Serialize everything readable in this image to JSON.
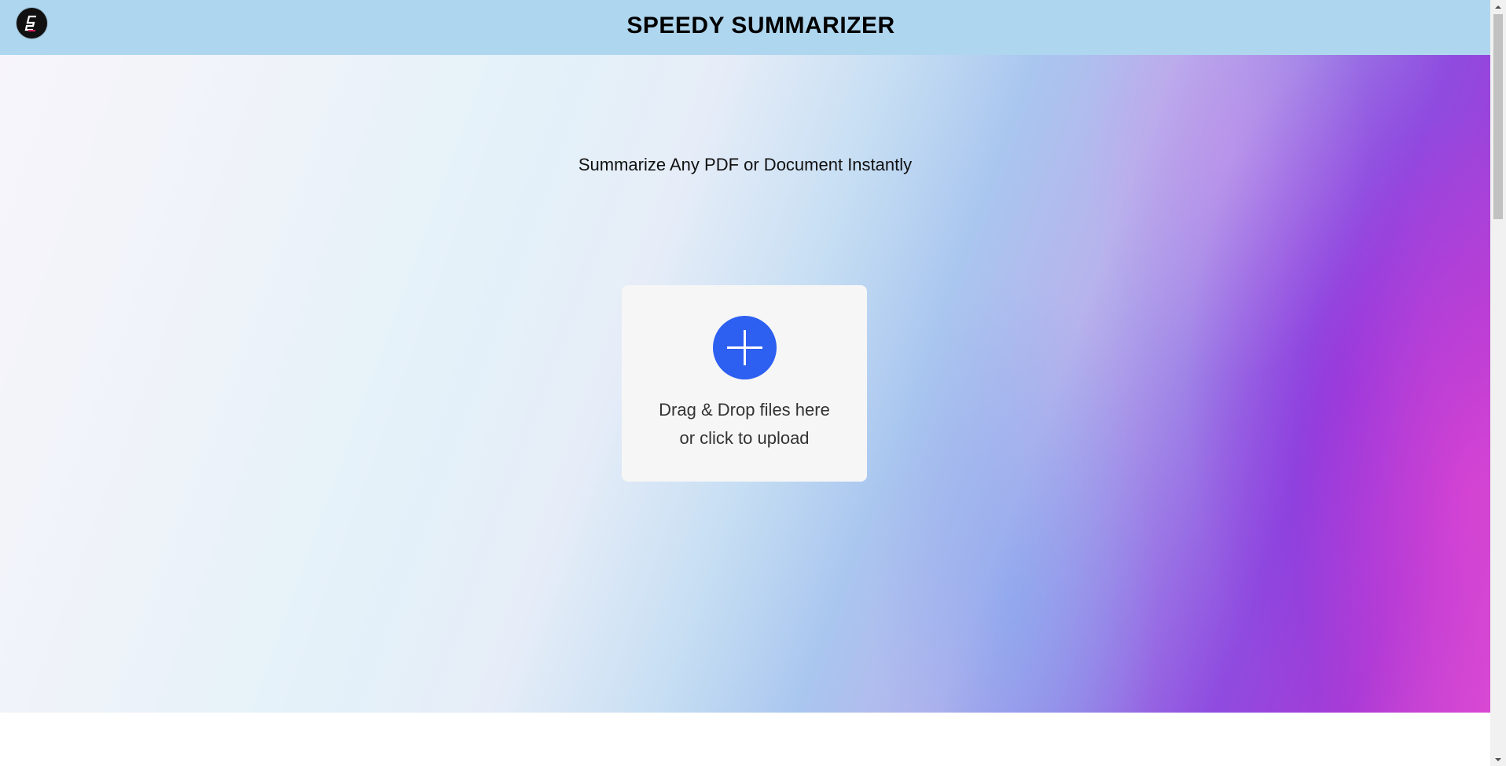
{
  "header": {
    "title": "SPEEDY SUMMARIZER",
    "logo_icon": "speedy-s-logo-icon",
    "background": "#afd6ef"
  },
  "hero": {
    "tagline": "Summarize Any PDF or Document Instantly"
  },
  "upload": {
    "icon": "plus-circle-icon",
    "accent": "#2d5ff1",
    "line1": "Drag & Drop files here",
    "line2": "or click to upload"
  },
  "scrollbar": {
    "up_icon": "scroll-up-arrow-icon",
    "down_icon": "scroll-down-arrow-icon"
  }
}
